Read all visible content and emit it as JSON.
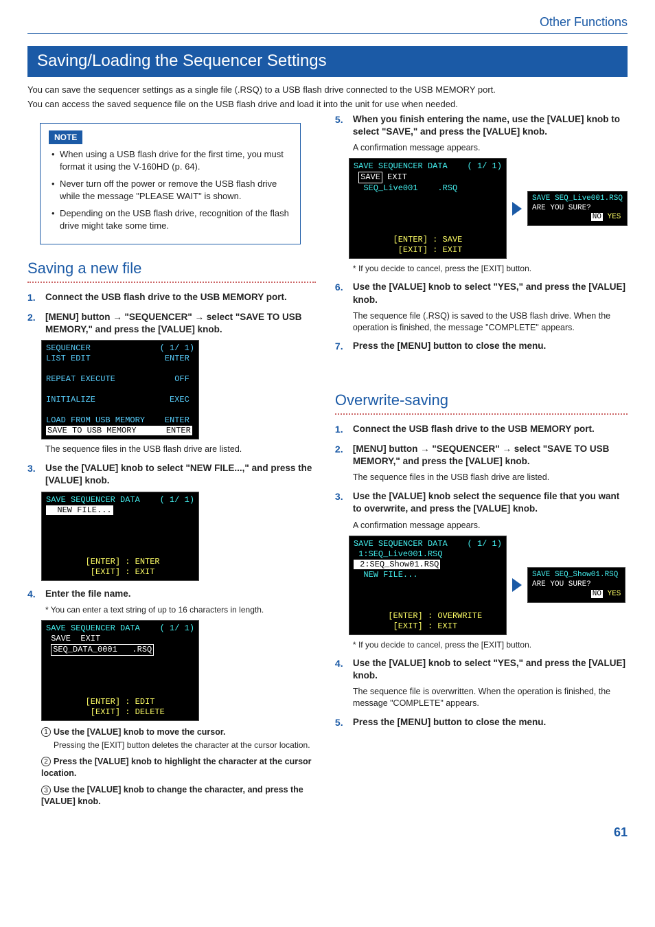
{
  "header": {
    "section": "Other Functions"
  },
  "title": "Saving/Loading the Sequencer Settings",
  "intro": {
    "p1": "You can save the sequencer settings as a single file (.RSQ) to a USB flash drive connected to the USB MEMORY port.",
    "p2": "You can access the saved sequence file on the USB flash drive and load it into the unit for use when needed."
  },
  "note": {
    "label": "NOTE",
    "items": [
      "When using a USB flash drive for the first time, you must format it using the V-160HD (p. 64).",
      "Never turn off the power or remove the USB flash drive while the message \"PLEASE WAIT\" is shown.",
      "Depending on the USB flash drive, recognition of the flash drive might take some time."
    ]
  },
  "saving": {
    "title": "Saving a new file",
    "s1": "Connect the USB flash drive to the USB MEMORY port.",
    "s2_a": "[MENU] button ",
    "s2_b": " \"SEQUENCER\" ",
    "s2_c": " select \"SAVE TO USB MEMORY,\" and press the [VALUE] knob.",
    "after2": "The sequence files in the USB flash drive are listed.",
    "s3": "Use the [VALUE] knob to select \"NEW FILE...,\" and press the [VALUE] knob.",
    "s4": "Enter the file name.",
    "after4": "You can enter a text string of up to 16 characters in length.",
    "sub1": "Use the [VALUE] knob to move the cursor.",
    "sub1_after": "Pressing the [EXIT] button deletes the character at the cursor location.",
    "sub2": "Press the [VALUE] knob to highlight the character at the cursor location.",
    "sub3": "Use the [VALUE] knob to change the character, and press the [VALUE] knob.",
    "s5": "When you finish entering the name, use the [VALUE] knob to select \"SAVE,\" and press the [VALUE] knob.",
    "after5": "A confirmation message appears.",
    "cancel": "If you decide to cancel, press the [EXIT] button.",
    "s6": "Use the [VALUE] knob to select \"YES,\" and press the [VALUE] knob.",
    "after6": "The sequence file (.RSQ) is saved to the USB flash drive. When the operation is finished, the message \"COMPLETE\" appears.",
    "s7": "Press the [MENU] button to close the menu."
  },
  "overwrite": {
    "title": "Overwrite-saving",
    "s1": "Connect the USB flash drive to the USB MEMORY port.",
    "s2_a": "[MENU] button ",
    "s2_b": " \"SEQUENCER\" ",
    "s2_c": " select \"SAVE TO USB MEMORY,\" and press the [VALUE] knob.",
    "after2": "The sequence files in the USB flash drive are listed.",
    "s3": "Use the [VALUE] knob select the sequence file that you want to overwrite, and press the [VALUE] knob.",
    "after3": "A confirmation message appears.",
    "cancel": "If you decide to cancel, press the [EXIT] button.",
    "s4": "Use the [VALUE] knob to select \"YES,\" and press the [VALUE] knob.",
    "after4": "The sequence file is overwritten. When the operation is finished, the message \"COMPLETE\" appears.",
    "s5": "Press the [MENU] button to close the menu."
  },
  "lcd": {
    "seq_menu": "SEQUENCER              ( 1/ 1)\nLIST EDIT               ENTER\n\nREPEAT EXECUTE            OFF\n\nINITIALIZE               EXEC\n\nLOAD FROM USB MEMORY    ENTER",
    "seq_menu_hl": "SAVE TO USB MEMORY      ENTER",
    "save_hdr": "SAVE SEQUENCER DATA    ( 1/ 1)",
    "newfile": "  NEW FILE...",
    "enter_footer": "        [ENTER] : ENTER\n         [EXIT] : EXIT",
    "name_save": " SAVE  EXIT",
    "name_box": "SEQ_DATA_0001   .RSQ",
    "edit_footer": "        [ENTER] : EDIT\n         [EXIT] : DELETE",
    "save_name2": "  SEQ_Live001    .RSQ",
    "save_footer": "        [ENTER] : SAVE\n         [EXIT] : EXIT",
    "confirm1_l1": "SAVE SEQ_Live001.RSQ",
    "confirm_l2": "ARE YOU SURE?",
    "confirm_yn": "NO YES",
    "ow_list": " 1:SEQ_Live001.RSQ",
    "ow_list_hl": " 2:SEQ_Show01.RSQ",
    "ow_new": "  NEW FILE...",
    "ow_footer": "       [ENTER] : OVERWRITE\n        [EXIT] : EXIT",
    "confirm2_l1": "SAVE SEQ_Show01.RSQ"
  },
  "labels": {
    "arrow": "→",
    "n1": "1",
    "n2": "2",
    "n3": "3"
  },
  "page": "61"
}
